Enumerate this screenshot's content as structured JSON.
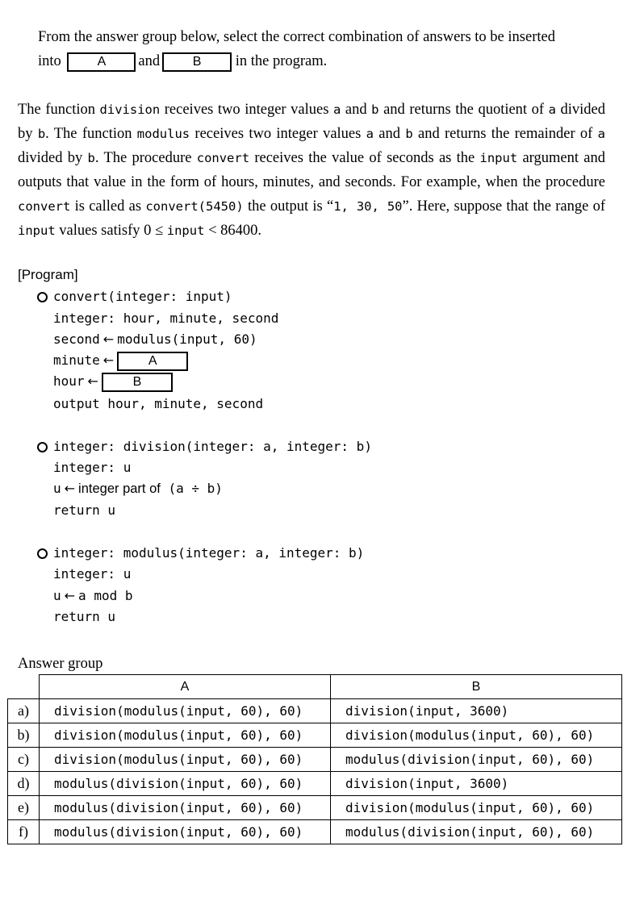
{
  "instruction": {
    "part1": "From the answer group below, select the correct combination of answers to be inserted",
    "into": "into",
    "box_a": "A",
    "and": "and",
    "box_b": "B",
    "rest": "in the program."
  },
  "description": {
    "t1": "The function ",
    "c1": "division",
    "t2": " receives two integer values ",
    "c2": "a",
    "t3": " and ",
    "c3": "b",
    "t4": " and returns the quotient of ",
    "c4": "a",
    "t5": " divided by ",
    "c5": "b",
    "t6": ". The function ",
    "c6": "modulus",
    "t7": " receives two integer values ",
    "c7": "a",
    "t8": " and ",
    "c8": "b",
    "t9": " and returns the remainder of ",
    "c9": "a",
    "t10": " divided by ",
    "c10": "b",
    "t11": ". The procedure ",
    "c11": "convert",
    "t12": " receives the value of seconds as the ",
    "c12": "input",
    "t13": " argument and outputs that value in the form of hours, minutes, and seconds. For example, when the procedure ",
    "c13": "convert",
    "t14": " is called as ",
    "c14": "convert(5450)",
    "t15": " the output is “",
    "c15": "1, 30, 50",
    "t16": "”. Here, suppose that the range of ",
    "c16": "input",
    "t17": " values satisfy 0 ≤ ",
    "c17": "input",
    "t18": " < 86400."
  },
  "program": {
    "heading": "[Program]",
    "convert": {
      "signature": "convert(integer: input)",
      "decl": "integer: hour, minute, second",
      "second_lhs": "second",
      "second_rhs": "modulus(input, 60)",
      "minute_lhs": "minute",
      "minute_box": "A",
      "hour_lhs": "hour",
      "hour_box": "B",
      "output": "output hour, minute, second"
    },
    "division": {
      "signature": "integer: division(integer: a, integer: b)",
      "decl": "integer: u",
      "assign_lhs": "u",
      "assign_text": "integer part of",
      "assign_expr": "(a ÷ b)",
      "ret": "return u"
    },
    "modulus": {
      "signature": "integer: modulus(integer: a, integer: b)",
      "decl": "integer: u",
      "assign_lhs": "u",
      "assign_rhs": "a mod b",
      "ret": "return u"
    }
  },
  "answer_group": {
    "heading": "Answer group",
    "col_a": "A",
    "col_b": "B",
    "rows": [
      {
        "label": "a)",
        "a": "division(modulus(input, 60), 60)",
        "b": "division(input, 3600)"
      },
      {
        "label": "b)",
        "a": "division(modulus(input, 60), 60)",
        "b": "division(modulus(input, 60), 60)"
      },
      {
        "label": "c)",
        "a": "division(modulus(input, 60), 60)",
        "b": "modulus(division(input, 60), 60)"
      },
      {
        "label": "d)",
        "a": "modulus(division(input, 60), 60)",
        "b": "division(input, 3600)"
      },
      {
        "label": "e)",
        "a": "modulus(division(input, 60), 60)",
        "b": "division(modulus(input, 60), 60)"
      },
      {
        "label": "f)",
        "a": "modulus(division(input, 60), 60)",
        "b": "modulus(division(input, 60), 60)"
      }
    ]
  }
}
